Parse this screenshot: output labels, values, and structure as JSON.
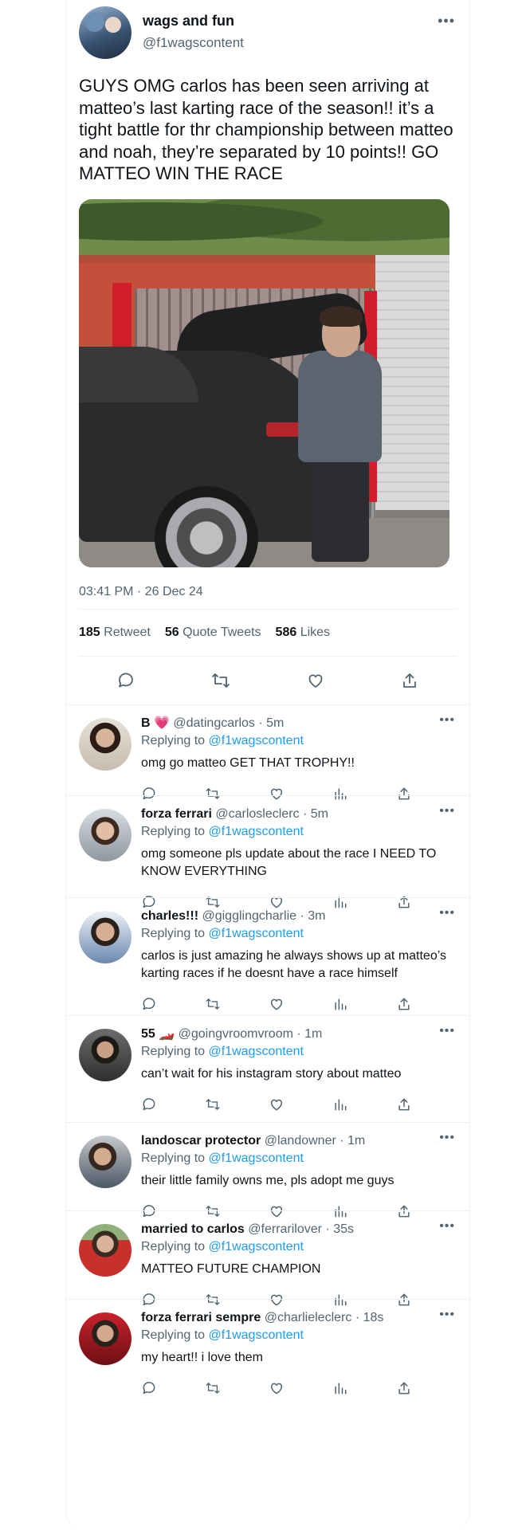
{
  "main_tweet": {
    "display_name": "wags and fun",
    "handle": "@f1wagscontent",
    "text": "GUYS OMG carlos has been seen arriving at matteo’s last karting race of the season!! it’s a tight battle for thr championship between matteo and noah, they’re separated by 10 points!! GO MATTEO WIN THE RACE",
    "timestamp": "03:41 PM · 26 Dec 24",
    "stats": {
      "retweets": "185",
      "retweets_label": "Retweet",
      "quotes": "56",
      "quotes_label": "Quote Tweets",
      "likes": "586",
      "likes_label": "Likes"
    },
    "more": "•••"
  },
  "replying_prefix": "Replying to ",
  "replies": [
    {
      "name": "B 💗",
      "handle": "@datingcarlos",
      "time": "· 5m",
      "reply_to": "@f1wagscontent",
      "text": "omg go matteo GET THAT TROPHY!!"
    },
    {
      "name": "forza ferrari",
      "handle": "@carlosleclerc",
      "time": "· 5m",
      "reply_to": "@f1wagscontent",
      "text": "omg someone pls update about the race I NEED TO KNOW EVERYTHING"
    },
    {
      "name": "charles!!!",
      "handle": "@gigglingcharlie",
      "time": "· 3m",
      "reply_to": "@f1wagscontent",
      "text": "carlos is just amazing he always shows up at matteo’s karting races if he doesnt have a race himself"
    },
    {
      "name": "55 🏎️",
      "handle": "@goingvroomvroom",
      "time": "· 1m",
      "reply_to": "@f1wagscontent",
      "text": "can’t wait for his instagram story about matteo"
    },
    {
      "name": "landoscar protector",
      "handle": "@landowner",
      "time": "· 1m",
      "reply_to": "@f1wagscontent",
      "text": "their little family owns me, pls adopt me guys"
    },
    {
      "name": "married to carlos",
      "handle": "@ferrarilover",
      "time": "· 35s",
      "reply_to": "@f1wagscontent",
      "text": "MATTEO FUTURE CHAMPION"
    },
    {
      "name": "forza ferrari sempre",
      "handle": "@charlieleclerc",
      "time": "· 18s",
      "reply_to": "@f1wagscontent",
      "text": "my heart!! i love them"
    }
  ],
  "icons": [
    "reply-icon",
    "retweet-icon",
    "like-icon",
    "views-icon",
    "share-icon",
    "more-icon"
  ]
}
